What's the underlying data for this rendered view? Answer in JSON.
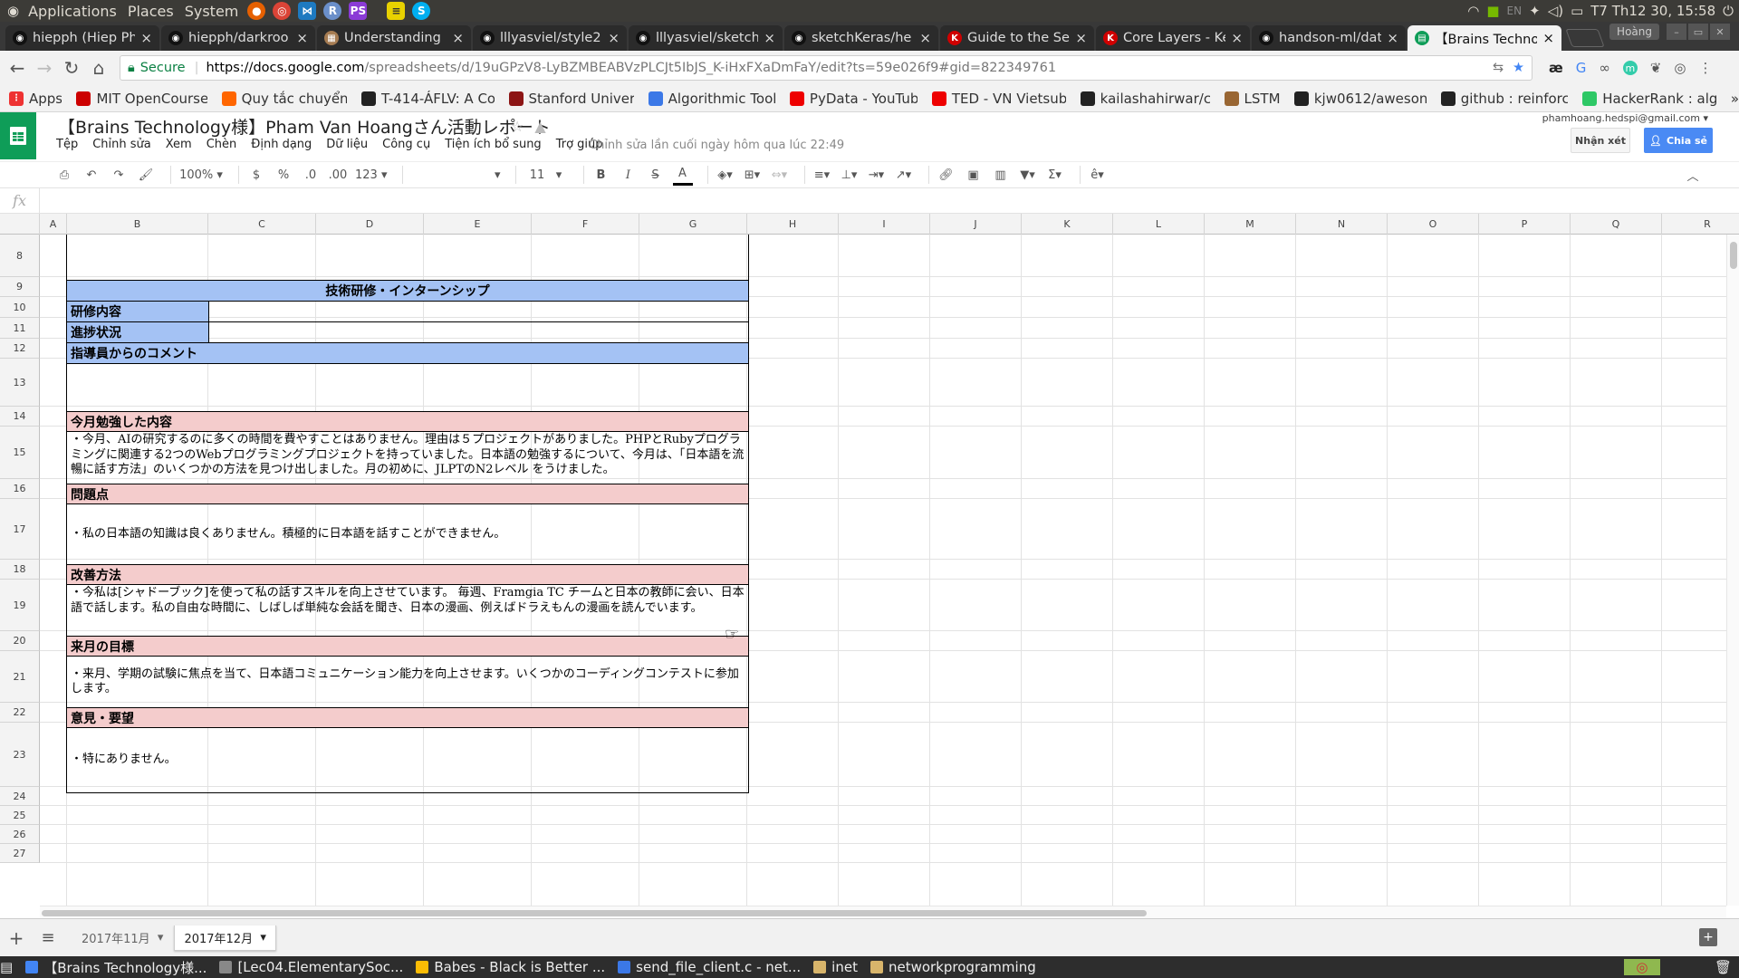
{
  "os_panel": {
    "menus": [
      "Applications",
      "Places",
      "System"
    ],
    "launchers": [
      "firefox-icon",
      "chrome-icon",
      "vscode-icon",
      "r-icon",
      "phpstorm-icon",
      "notes-icon",
      "skype-icon"
    ],
    "tray": {
      "lang": "EN",
      "datetime": "T7 Th12 30, 15:58"
    }
  },
  "browser": {
    "tabs": [
      {
        "title": "hiepph (Hiep Ph",
        "icon": "github-icon",
        "active": false
      },
      {
        "title": "hiepph/darkroo",
        "icon": "github-icon",
        "active": false
      },
      {
        "title": "Understanding",
        "icon": "page-icon",
        "active": false
      },
      {
        "title": "lllyasviel/style2",
        "icon": "github-icon",
        "active": false
      },
      {
        "title": "lllyasviel/sketch",
        "icon": "github-icon",
        "active": false
      },
      {
        "title": "sketchKeras/he",
        "icon": "github-icon",
        "active": false
      },
      {
        "title": "Guide to the Sec",
        "icon": "keras-icon",
        "active": false
      },
      {
        "title": "Core Layers - Ke",
        "icon": "keras-icon",
        "active": false
      },
      {
        "title": "handson-ml/dat",
        "icon": "github-icon",
        "active": false
      },
      {
        "title": "【Brains Techno",
        "icon": "sheets-icon",
        "active": true
      }
    ],
    "profile": "Hoàng",
    "address": {
      "secure": "Secure",
      "host": "https://docs.google.com",
      "path": "/spreadsheets/d/19uGPzV8-LyBZMBEABVzPLCJt5IbJS_K-iHxFXaDmFaY/edit?ts=59e026f9#gid=822349761"
    },
    "bookmarks": [
      {
        "label": "Apps",
        "color": "#e33"
      },
      {
        "label": "MIT OpenCourse",
        "color": "#c00"
      },
      {
        "label": "Quy tắc chuyển",
        "color": "#f60"
      },
      {
        "label": "T-414-ÁFLV: A Co",
        "color": "#222"
      },
      {
        "label": "Stanford Univer",
        "color": "#8c1515"
      },
      {
        "label": "Algorithmic Tool",
        "color": "#3b78e7"
      },
      {
        "label": "PyData - YouTub",
        "color": "#e00"
      },
      {
        "label": "TED - VN Vietsub",
        "color": "#e00"
      },
      {
        "label": "kailashahirwar/c",
        "color": "#222"
      },
      {
        "label": "LSTM",
        "color": "#963"
      },
      {
        "label": "kjw0612/aweson",
        "color": "#222"
      },
      {
        "label": "github : reinforc",
        "color": "#222"
      },
      {
        "label": "HackerRank : alg",
        "color": "#2ec866"
      }
    ]
  },
  "sheets": {
    "title": "【Brains Technology様】Pham Van Hoangさん活動レポート",
    "menus": [
      "Tệp",
      "Chỉnh sửa",
      "Xem",
      "Chèn",
      "Định dạng",
      "Dữ liệu",
      "Công cụ",
      "Tiện ích bổ sung",
      "Trợ giúp"
    ],
    "last_edit": "Chỉnh sửa lần cuối ngày hôm qua lúc 22:49",
    "user_email": "phamhoang.hedspi@gmail.com",
    "comments_label": "Nhận xét",
    "share_label": "Chia sẻ",
    "toolbar": {
      "zoom": "100%",
      "currency": "$",
      "percent": "%",
      "dec_less": ".0",
      "dec_more": ".00",
      "format": "123",
      "font_size": "11"
    },
    "fx_label": "fx",
    "columns": [
      "A",
      "B",
      "C",
      "D",
      "E",
      "F",
      "G",
      "H",
      "I",
      "J",
      "K",
      "L",
      "M",
      "N",
      "O",
      "P",
      "Q",
      "R"
    ],
    "rows": [
      "8",
      "9",
      "10",
      "11",
      "12",
      "13",
      "14",
      "15",
      "16",
      "17",
      "18",
      "19",
      "20",
      "21",
      "22",
      "23",
      "24",
      "25",
      "26",
      "27"
    ],
    "report": {
      "section_title": "技術研修・インターンシップ",
      "training_label": "研修内容",
      "progress_label": "進捗状況",
      "instructor_comment": "指導員からのコメント",
      "studied_header": "今月勉強した内容",
      "studied_body": "・今月、AIの研究するのに多くの時間を費やすことはありません。理由は５プロジェクトがありました。PHPとRubyプログラミングに関連する2つのWebプログラミングプロジェクトを持っていました。日本語の勉強するについて、今月は、「日本語を流暢に話す方法」のいくつかの方法を見つけ出しました。月の初めに、JLPTのN2レベル をうけました。",
      "problems_header": "問題点",
      "problems_body": "・私の日本語の知識は良くありません。積極的に日本語を話すことができません。",
      "improve_header": "改善方法",
      "improve_body": "・今私は[シャドーブック]を使って私の話すスキルを向上させています。 毎週、Framgia TC チームと日本の教師に会い、日本語で話します。私の自由な時間に、しばしば単純な会話を聞き、日本の漫画、例えばドラえもんの漫画を読んでいます。",
      "goal_header": "来月の目標",
      "goal_body": "・来月、学期の試験に焦点を当て、日本語コミュニケーション能力を向上させます。いくつかのコーディングコンテストに参加します。",
      "opinion_header": "意見・要望",
      "opinion_body": "・特にありません。"
    },
    "sheet_tabs": [
      {
        "label": "2017年11月",
        "active": false
      },
      {
        "label": "2017年12月",
        "active": true
      }
    ]
  },
  "taskbar": [
    {
      "label": "【Brains Technology様...",
      "color": "#4285f4"
    },
    {
      "label": "[Lec04.ElementarySoc...",
      "color": "#888"
    },
    {
      "label": "Babes - Black is Better ...",
      "color": "#fbbc05"
    },
    {
      "label": "send_file_client.c - net...",
      "color": "#3b78e7"
    },
    {
      "label": "inet",
      "color": "#d8b56b"
    },
    {
      "label": "networkprogramming",
      "color": "#d8b56b"
    }
  ],
  "colors": {
    "blue_header": "#a4c2f4",
    "pink_header": "#f4cccc",
    "sheets_green": "#0f9d58",
    "share_blue": "#4a8af4"
  }
}
